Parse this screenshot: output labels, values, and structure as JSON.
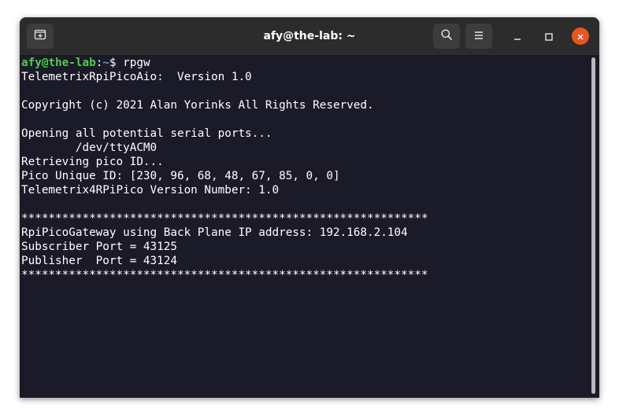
{
  "window": {
    "title": "afy@the-lab: ~",
    "icons": {
      "new_tab": "new-tab-icon",
      "search": "search-icon",
      "menu": "hamburger-menu-icon",
      "minimize": "minimize-icon",
      "maximize": "maximize-icon",
      "close": "close-icon"
    },
    "colors": {
      "titlebar": "#2c2c2c",
      "terminal_bg": "#1b1a29",
      "close_button": "#e95420",
      "prompt_user": "#4fcc4f",
      "prompt_path": "#6c8fe0"
    }
  },
  "terminal": {
    "prompt": {
      "user_host": "afy@the-lab",
      "sep": ":",
      "path": "~",
      "symbol": "$ ",
      "command": "rpgw"
    },
    "lines": [
      "TelemetrixRpiPicoAio:  Version 1.0",
      "",
      "Copyright (c) 2021 Alan Yorinks All Rights Reserved.",
      "",
      "Opening all potential serial ports...",
      "        /dev/ttyACM0",
      "Retrieving pico ID...",
      "Pico Unique ID: [230, 96, 68, 48, 67, 85, 0, 0]",
      "Telemetrix4RPiPico Version Number: 1.0",
      "",
      "************************************************************",
      "RpiPicoGateway using Back Plane IP address: 192.168.2.104",
      "Subscriber Port = 43125",
      "Publisher  Port = 43124",
      "************************************************************"
    ]
  }
}
